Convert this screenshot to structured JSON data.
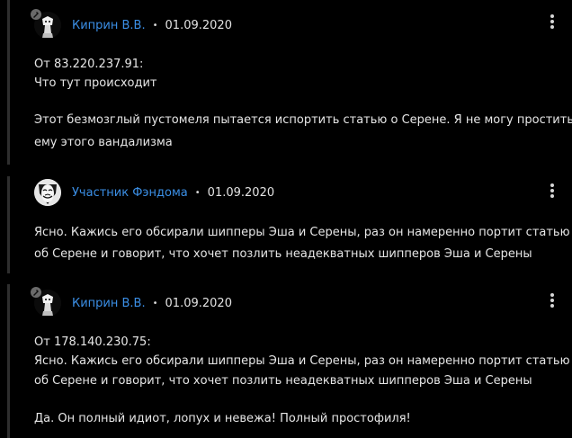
{
  "comments": [
    {
      "author": "Киприн В.В.",
      "separator": "•",
      "date": "01.09.2020",
      "avatar_icon": "anime-character-avatar",
      "lines": [
        "От 83.220.237.91:",
        "Что тут происходит",
        "",
        "Этот безмозглый пустомеля пытается испортить статью о Серене. Я не могу простить",
        "ему этого вандализма"
      ]
    },
    {
      "author": "Участник Фэндома",
      "separator": "•",
      "date": "01.09.2020",
      "avatar_icon": "guy-fawkes-mask-avatar",
      "lines": [
        "Ясно. Кажись его обсирали шипперы Эша и Серены, раз он намеренно портит статью",
        "об Серене и говорит, что хочет позлить неадекватных шипперов Эша и Серены"
      ]
    },
    {
      "author": "Киприн В.В.",
      "separator": "•",
      "date": "01.09.2020",
      "avatar_icon": "anime-character-avatar",
      "lines": [
        "От 178.140.230.75:",
        "Ясно. Кажись его обсирали шипперы Эша и Серены, раз он намеренно портит статью",
        "об Серене и говорит, что хочет позлить неадекватных шипперов Эша и Серены",
        "",
        "Да. Он полный идиот, лопух и невежа! Полный простофиля!"
      ]
    }
  ],
  "colors": {
    "background": "#000000",
    "author_link": "#3b8fe6",
    "text": "#e6e6e6",
    "thread_line": "#2e2e2e"
  }
}
